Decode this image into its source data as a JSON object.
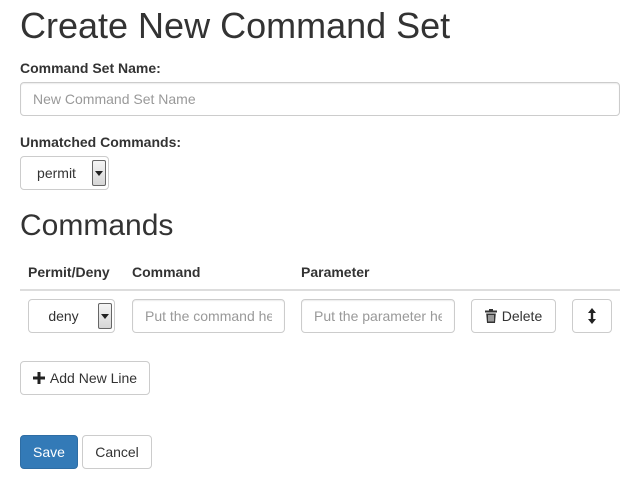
{
  "page": {
    "title": "Create New Command Set"
  },
  "name_field": {
    "label": "Command Set Name:",
    "value": "",
    "placeholder": "New Command Set Name"
  },
  "unmatched": {
    "label": "Unmatched Commands:",
    "selected": "permit"
  },
  "commands": {
    "title": "Commands",
    "columns": [
      "Permit/Deny",
      "Command",
      "Parameter"
    ],
    "rows": [
      {
        "action": "deny",
        "command_placeholder": "Put the command here",
        "parameter_placeholder": "Put the parameter here",
        "delete_label": "Delete"
      }
    ]
  },
  "actions": {
    "add_line_label": "Add New Line",
    "save_label": "Save",
    "cancel_label": "Cancel"
  },
  "icons": {
    "select_arrow": "caret-down-icon",
    "delete": "trash-icon",
    "reorder": "vertical-resize-icon",
    "add": "plus-icon"
  },
  "colors": {
    "primary": "#337ab7",
    "border": "#cccccc",
    "text": "#333333",
    "placeholder": "#999999"
  }
}
